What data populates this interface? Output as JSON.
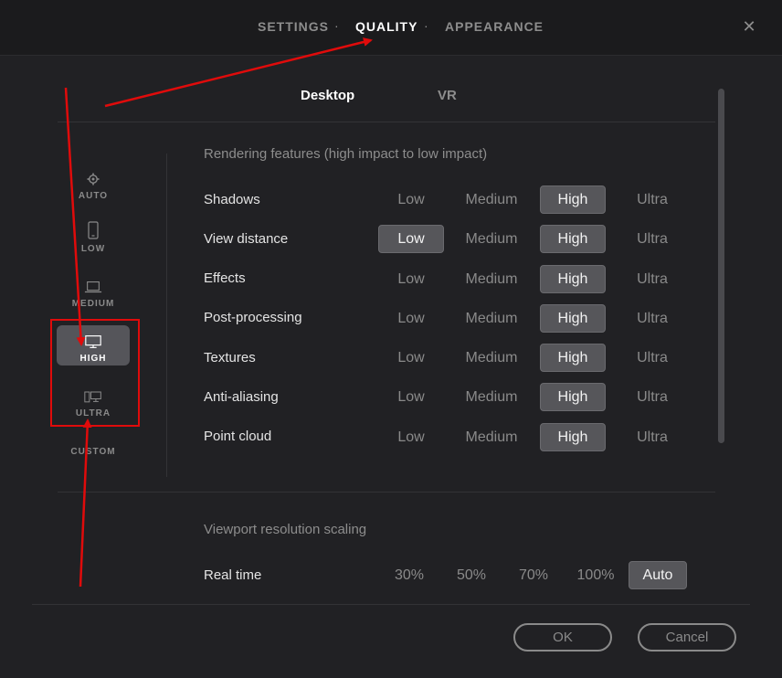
{
  "top_tabs": [
    {
      "label": "SETTINGS",
      "active": false
    },
    {
      "label": "QUALITY",
      "active": true
    },
    {
      "label": "APPEARANCE",
      "active": false
    }
  ],
  "separator": "·",
  "close_icon": "✕",
  "sub_tabs": [
    {
      "label": "Desktop",
      "active": true
    },
    {
      "label": "VR",
      "active": false
    }
  ],
  "presets": [
    {
      "label": "AUTO",
      "icon": "gear-icon",
      "active": false
    },
    {
      "label": "LOW",
      "icon": "phone-icon",
      "active": false
    },
    {
      "label": "MEDIUM",
      "icon": "laptop-icon",
      "active": false
    },
    {
      "label": "HIGH",
      "icon": "monitor-icon",
      "active": true
    },
    {
      "label": "ULTRA",
      "icon": "pc-tower-monitor-icon",
      "active": false
    },
    {
      "label": "CUSTOM",
      "icon": "",
      "active": false
    }
  ],
  "rendering": {
    "title": "Rendering features (high impact to low impact)",
    "levels": [
      "Low",
      "Medium",
      "High",
      "Ultra"
    ],
    "rows": [
      {
        "label": "Shadows",
        "selected": [
          "High"
        ]
      },
      {
        "label": "View distance",
        "selected": [
          "Low",
          "High"
        ]
      },
      {
        "label": "Effects",
        "selected": [
          "High"
        ]
      },
      {
        "label": "Post-processing",
        "selected": [
          "High"
        ]
      },
      {
        "label": "Textures",
        "selected": [
          "High"
        ]
      },
      {
        "label": "Anti-aliasing",
        "selected": [
          "High"
        ]
      },
      {
        "label": "Point cloud",
        "selected": [
          "High"
        ]
      }
    ]
  },
  "viewport": {
    "title": "Viewport resolution scaling",
    "row_label": "Real time",
    "options": [
      "30%",
      "50%",
      "70%",
      "100%",
      "Auto"
    ],
    "selected": "Auto"
  },
  "buttons": {
    "ok": "OK",
    "cancel": "Cancel"
  },
  "annotation_color": "#e00b0b"
}
